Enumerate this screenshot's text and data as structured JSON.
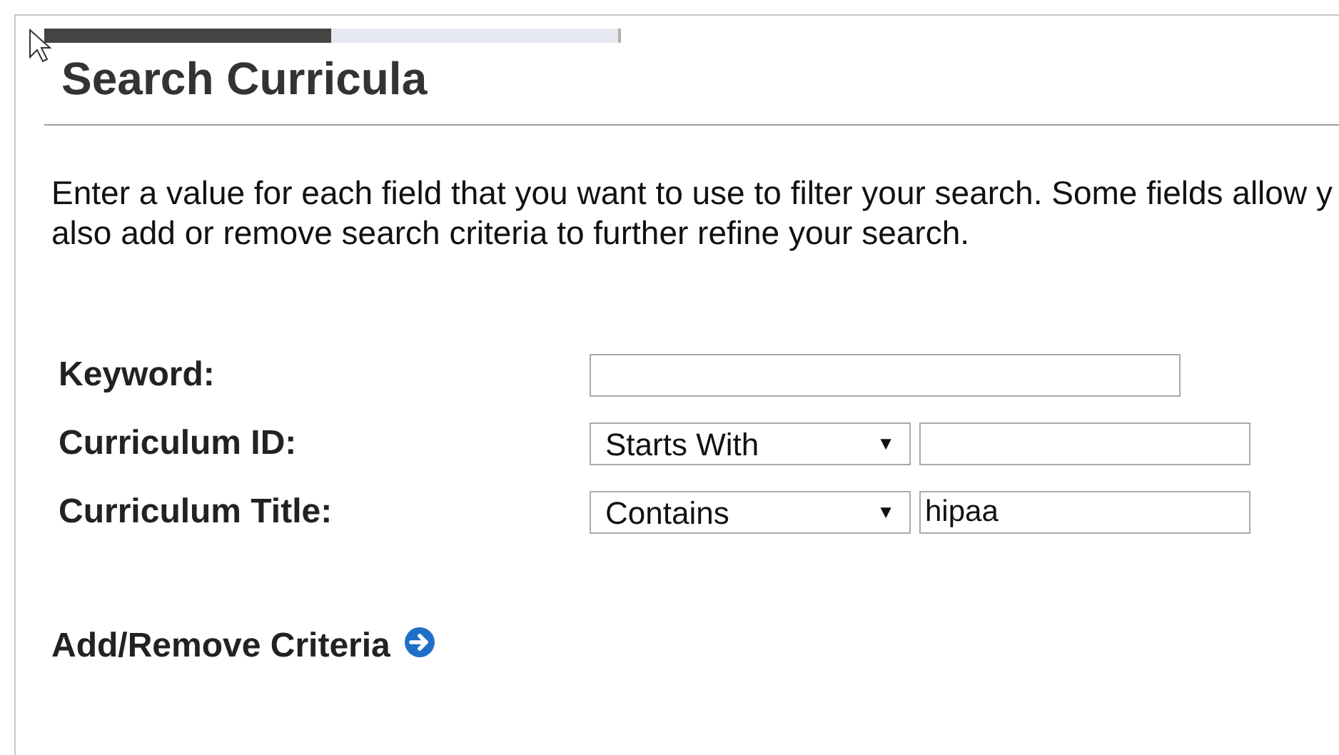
{
  "progress": {
    "level": 0.5
  },
  "title": "Search Curricula",
  "instructions": [
    "Enter a value for each field that you want to use to filter your search. Some fields allow y",
    "also add or remove search criteria to further refine your search."
  ],
  "fields": [
    {
      "kind": "text",
      "label": "Keyword:"
    },
    {
      "kind": "operator",
      "label": "Curriculum ID:",
      "operator": "Starts With",
      "arrow": "▼"
    },
    {
      "kind": "operator",
      "label": "Curriculum Title:",
      "operator": "Contains",
      "arrow": "▼",
      "value": "hipaa"
    }
  ],
  "criteria_link": "Add/Remove Criteria"
}
